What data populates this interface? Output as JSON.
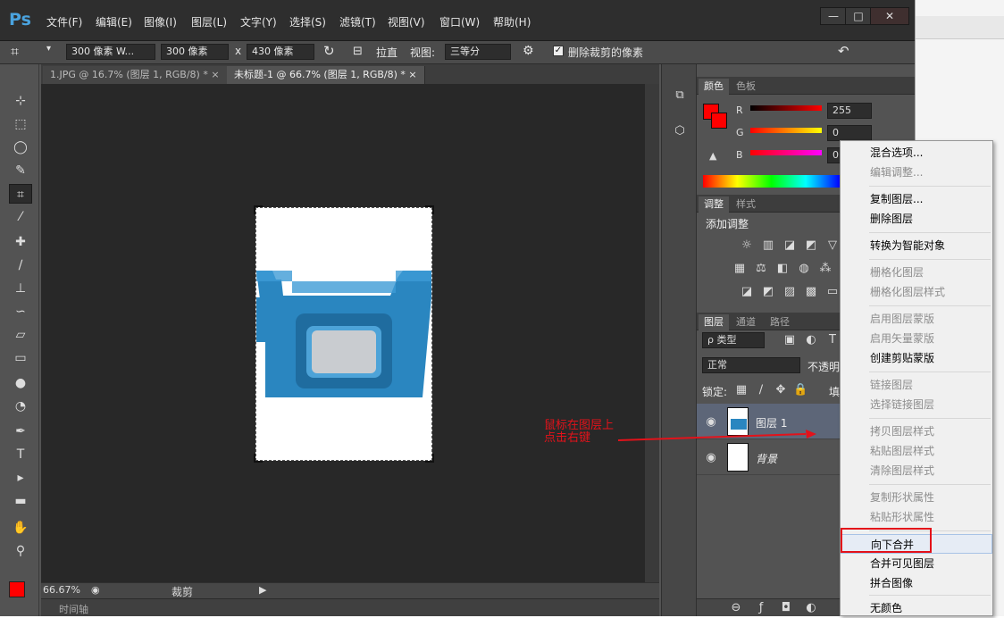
{
  "app": {
    "logo": "Ps",
    "menu": [
      "文件(F)",
      "编辑(E)",
      "图像(I)",
      "图层(L)",
      "文字(Y)",
      "选择(S)",
      "滤镜(T)",
      "视图(V)",
      "窗口(W)",
      "帮助(H)"
    ],
    "window_controls": {
      "minimize": "—",
      "maximize": "□",
      "close": "✕"
    }
  },
  "options_bar": {
    "preset": "300 像素  W...",
    "width": "300 像素",
    "x_sep": "x",
    "height": "430 像素",
    "straighten": "拉直",
    "view_label": "视图:",
    "view_value": "三等分",
    "delete_cropped": "删除裁剪的像素",
    "delete_cropped_checked": true
  },
  "doc_tabs": [
    {
      "label": "1.JPG @ 16.7% (图层 1, RGB/8) *",
      "active": false
    },
    {
      "label": "未标题-1 @ 66.7% (图层 1, RGB/8) *",
      "active": true
    }
  ],
  "status": {
    "zoom": "66.67%",
    "tool_label": "裁剪",
    "timeline": "时间轴"
  },
  "color_panel": {
    "tabs": [
      "颜色",
      "色板"
    ],
    "r_label": "R",
    "r_value": "255",
    "g_label": "G",
    "g_value": "0",
    "b_label": "B",
    "b_value": "0"
  },
  "adjust_panel": {
    "tabs": [
      "调整",
      "样式"
    ],
    "title": "添加调整"
  },
  "layers_panel": {
    "tabs": [
      "图层",
      "通道",
      "路径"
    ],
    "filter_label": "ρ 类型",
    "blend_mode": "正常",
    "opacity_label": "不透明",
    "lock_label": "锁定:",
    "fill_label": "填",
    "layers": [
      {
        "name": "图层 1",
        "selected": true
      },
      {
        "name": "背景",
        "selected": false
      }
    ]
  },
  "context_menu": [
    {
      "label": "混合选项...",
      "enabled": true
    },
    {
      "label": "编辑调整...",
      "enabled": false
    },
    {
      "label": "复制图层...",
      "enabled": true
    },
    {
      "label": "删除图层",
      "enabled": true
    },
    {
      "label": "转换为智能对象",
      "enabled": true
    },
    {
      "label": "栅格化图层",
      "enabled": false
    },
    {
      "label": "栅格化图层样式",
      "enabled": false
    },
    {
      "label": "启用图层蒙版",
      "enabled": false
    },
    {
      "label": "启用矢量蒙版",
      "enabled": false
    },
    {
      "label": "创建剪贴蒙版",
      "enabled": true
    },
    {
      "label": "链接图层",
      "enabled": false
    },
    {
      "label": "选择链接图层",
      "enabled": false
    },
    {
      "label": "拷贝图层样式",
      "enabled": false
    },
    {
      "label": "粘贴图层样式",
      "enabled": false
    },
    {
      "label": "清除图层样式",
      "enabled": false
    },
    {
      "label": "复制形状属性",
      "enabled": false
    },
    {
      "label": "粘贴形状属性",
      "enabled": false
    },
    {
      "label": "向下合并",
      "enabled": true,
      "highlighted": true
    },
    {
      "label": "合并可见图层",
      "enabled": true
    },
    {
      "label": "拼合图像",
      "enabled": true
    },
    {
      "label": "无颜色",
      "enabled": true
    }
  ],
  "annotation": {
    "line1": "鼠标在图层上",
    "line2": "点击右键",
    "color": "#e3121a"
  },
  "colors": {
    "foreground": "#ff0000",
    "background": "#ff0000",
    "object_blue": "#2a86c0"
  }
}
